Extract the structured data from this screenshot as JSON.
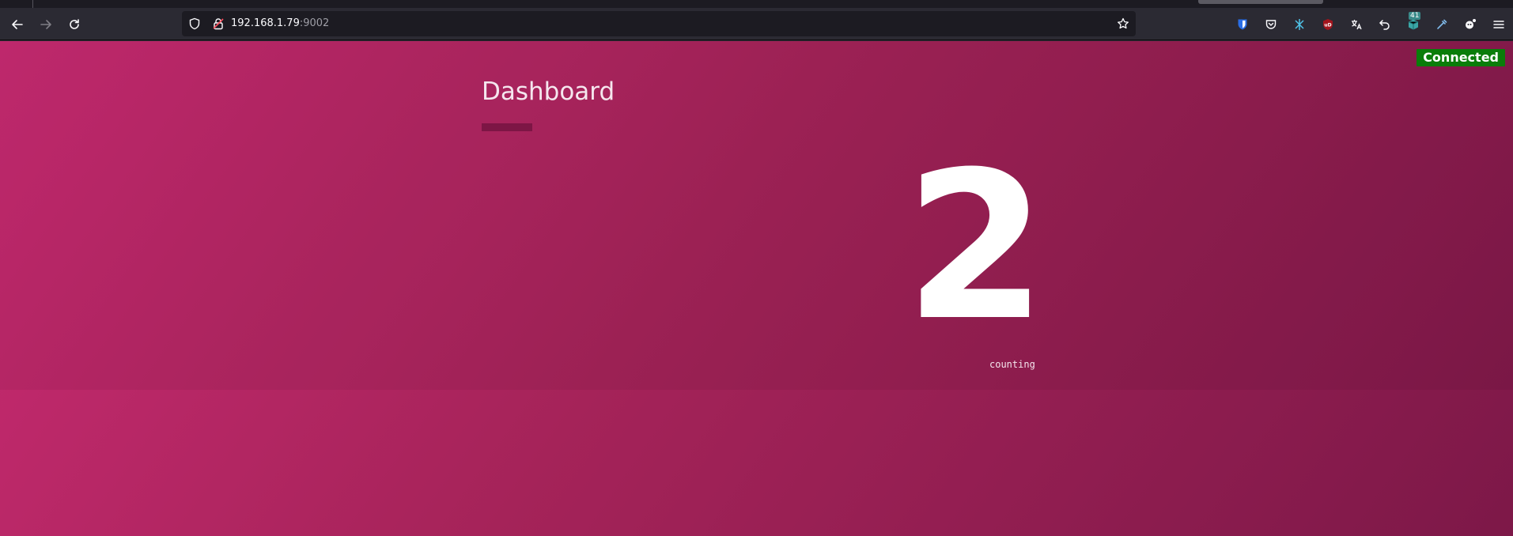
{
  "browser": {
    "url_host": "192.168.1.79",
    "url_port": ":9002",
    "extension_badge": "41"
  },
  "page": {
    "status": "Connected",
    "title": "Dashboard",
    "counter_value": "2",
    "counter_label": "counting"
  },
  "colors": {
    "status_bg": "#0a7d0a",
    "gradient_start": "#c92b72",
    "gradient_end": "#7d1848"
  },
  "icons": {
    "back": "arrow-left-icon",
    "forward": "arrow-right-icon",
    "reload": "reload-icon",
    "shield": "shield-icon",
    "lock": "insecure-lock-icon",
    "star": "star-icon",
    "menu": "hamburger-menu-icon"
  }
}
